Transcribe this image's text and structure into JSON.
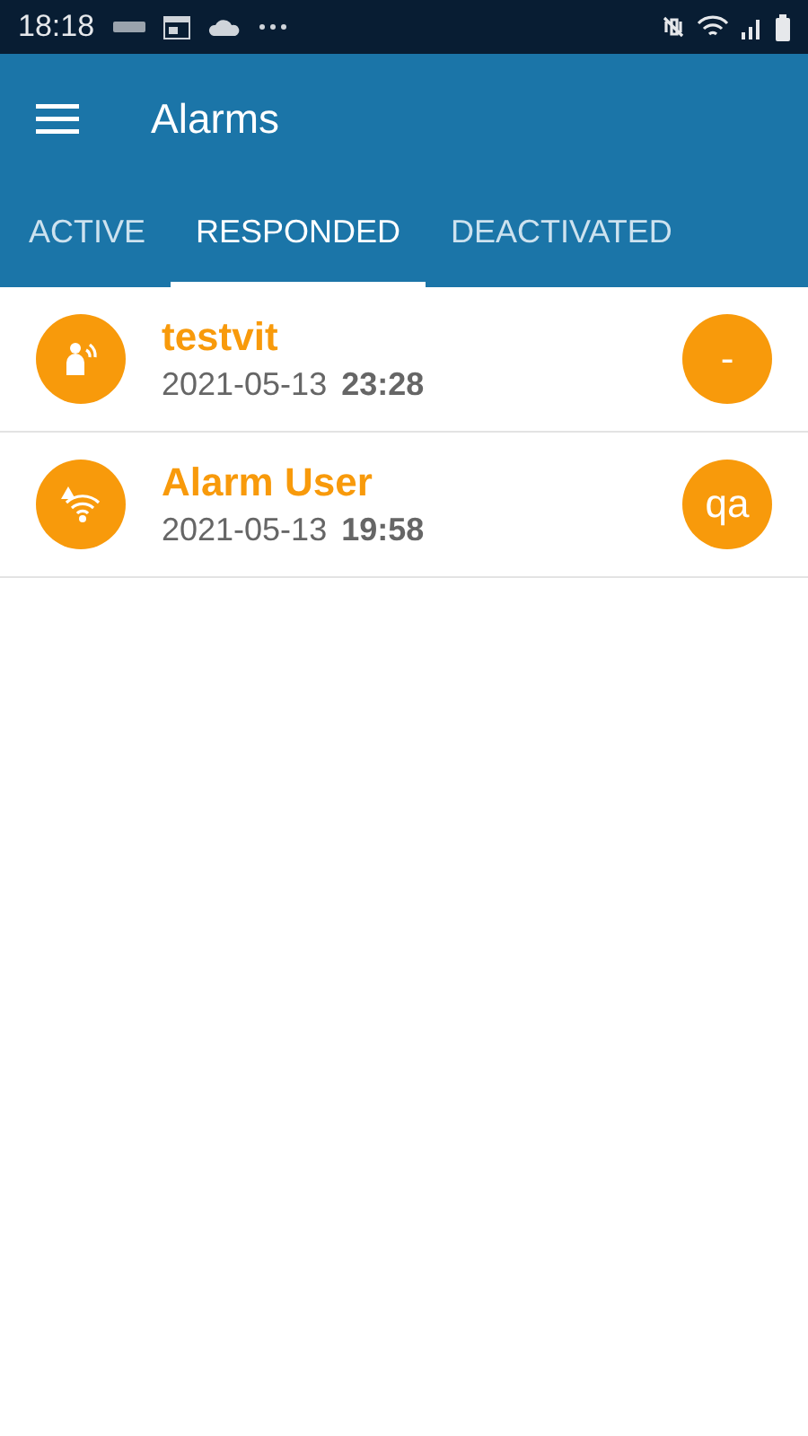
{
  "status_bar": {
    "time": "18:18"
  },
  "app_bar": {
    "title": "Alarms"
  },
  "tabs": [
    {
      "label": "ACTIVE",
      "selected": false
    },
    {
      "label": "RESPONDED",
      "selected": true
    },
    {
      "label": "DEACTIVATED",
      "selected": false
    }
  ],
  "alarms": [
    {
      "kind": "person",
      "name": "testvit",
      "date": "2021-05-13",
      "time": "23:28",
      "badge": "-"
    },
    {
      "kind": "wireless",
      "name": "Alarm User",
      "date": "2021-05-13",
      "time": "19:58",
      "badge": "qa"
    }
  ]
}
